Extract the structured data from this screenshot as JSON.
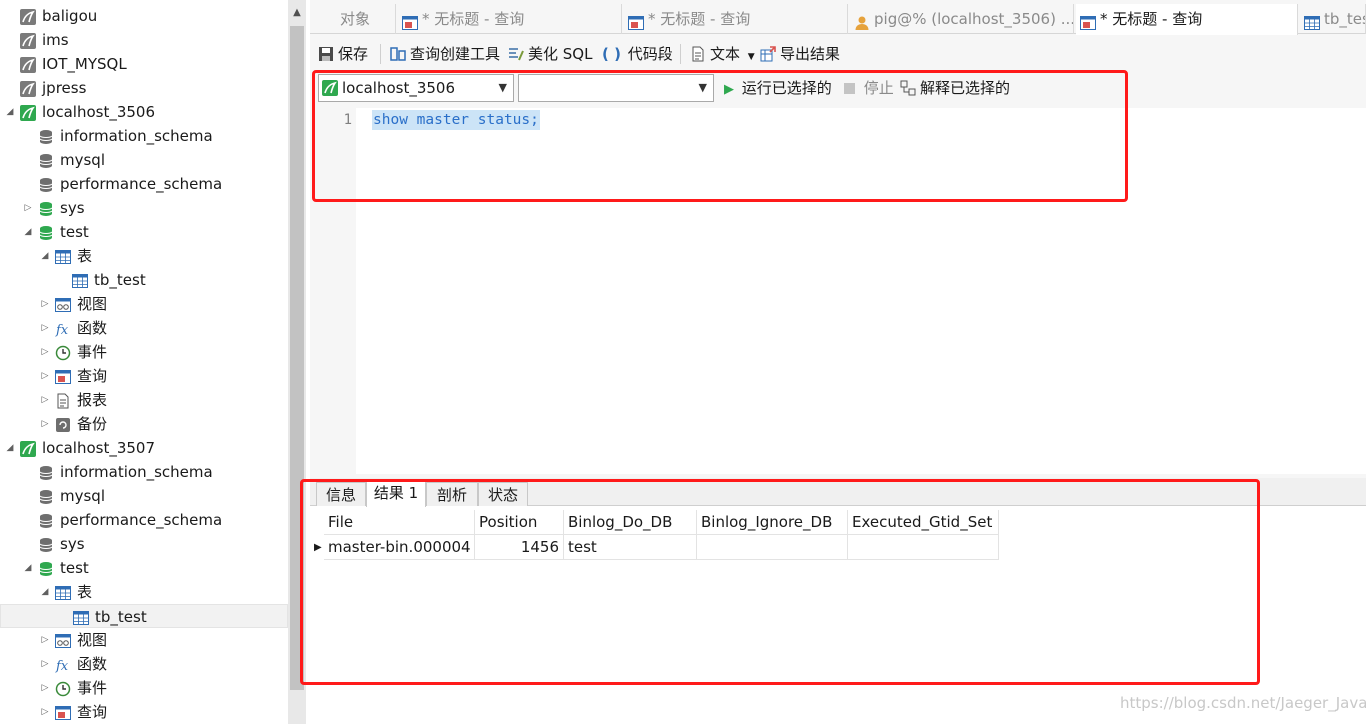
{
  "sidebar": {
    "items": [
      {
        "label": "baligou",
        "type": "server-off",
        "level": 0
      },
      {
        "label": "ims",
        "type": "server-off",
        "level": 0
      },
      {
        "label": "IOT_MYSQL",
        "type": "server-off",
        "level": 0
      },
      {
        "label": "jpress",
        "type": "server-off",
        "level": 0
      },
      {
        "label": "localhost_3506",
        "type": "server-on",
        "level": 0
      },
      {
        "label": "information_schema",
        "type": "db-off",
        "level": 1
      },
      {
        "label": "mysql",
        "type": "db-off",
        "level": 1
      },
      {
        "label": "performance_schema",
        "type": "db-off",
        "level": 1
      },
      {
        "label": "sys",
        "type": "db-on",
        "level": 1
      },
      {
        "label": "test",
        "type": "db-on",
        "level": 1
      },
      {
        "label": "表",
        "type": "tables",
        "level": 2
      },
      {
        "label": "tb_test",
        "type": "table",
        "level": 3
      },
      {
        "label": "视图",
        "type": "views",
        "level": 2
      },
      {
        "label": "函数",
        "type": "functions",
        "level": 2
      },
      {
        "label": "事件",
        "type": "events",
        "level": 2
      },
      {
        "label": "查询",
        "type": "queries",
        "level": 2
      },
      {
        "label": "报表",
        "type": "reports",
        "level": 2
      },
      {
        "label": "备份",
        "type": "backups",
        "level": 2
      },
      {
        "label": "localhost_3507",
        "type": "server-on",
        "level": 0
      },
      {
        "label": "information_schema",
        "type": "db-off",
        "level": 1
      },
      {
        "label": "mysql",
        "type": "db-off",
        "level": 1
      },
      {
        "label": "performance_schema",
        "type": "db-off",
        "level": 1
      },
      {
        "label": "sys",
        "type": "db-off",
        "level": 1
      },
      {
        "label": "test",
        "type": "db-on",
        "level": 1
      },
      {
        "label": "表",
        "type": "tables",
        "level": 2
      },
      {
        "label": "tb_test",
        "type": "table",
        "level": 3,
        "selected": true
      },
      {
        "label": "视图",
        "type": "views",
        "level": 2
      },
      {
        "label": "函数",
        "type": "functions",
        "level": 2
      },
      {
        "label": "事件",
        "type": "events",
        "level": 2
      },
      {
        "label": "查询",
        "type": "queries",
        "level": 2
      }
    ]
  },
  "tabs": [
    {
      "label": "对象",
      "icon": "none"
    },
    {
      "label": "* 无标题 - 查询",
      "icon": "query-icon"
    },
    {
      "label": "* 无标题 - 查询",
      "icon": "query-icon"
    },
    {
      "label": "pig@% (localhost_3506) ...",
      "icon": "user-icon"
    },
    {
      "label": "* 无标题 - 查询",
      "icon": "query-icon",
      "active": true
    },
    {
      "label": "tb_tes",
      "icon": "table-icon"
    }
  ],
  "toolbar": {
    "save": "保存",
    "query_builder": "查询创建工具",
    "beautify": "美化 SQL",
    "snippet": "代码段",
    "text": "文本",
    "export": "导出结果"
  },
  "querybar": {
    "connection": "localhost_3506",
    "database": "",
    "run_selected": "运行已选择的",
    "stop": "停止",
    "explain_selected": "解释已选择的"
  },
  "editor": {
    "line_number": "1",
    "code": "show master status;"
  },
  "results": {
    "tabs": [
      "信息",
      "结果 1",
      "剖析",
      "状态"
    ],
    "active_tab": 1,
    "columns": [
      "File",
      "Position",
      "Binlog_Do_DB",
      "Binlog_Ignore_DB",
      "Executed_Gtid_Set"
    ],
    "rows": [
      [
        "master-bin.000004",
        "1456",
        "test",
        "",
        ""
      ]
    ]
  },
  "watermark": "https://blog.csdn.net/Jaeger_Java",
  "colors": {
    "annotation": "#ff1a1a",
    "server_on": "#2fa84f",
    "db_on": "#2fa84f",
    "run": "#2fa84f",
    "code": "#2a6fc9",
    "selection": "#cce4f7"
  }
}
